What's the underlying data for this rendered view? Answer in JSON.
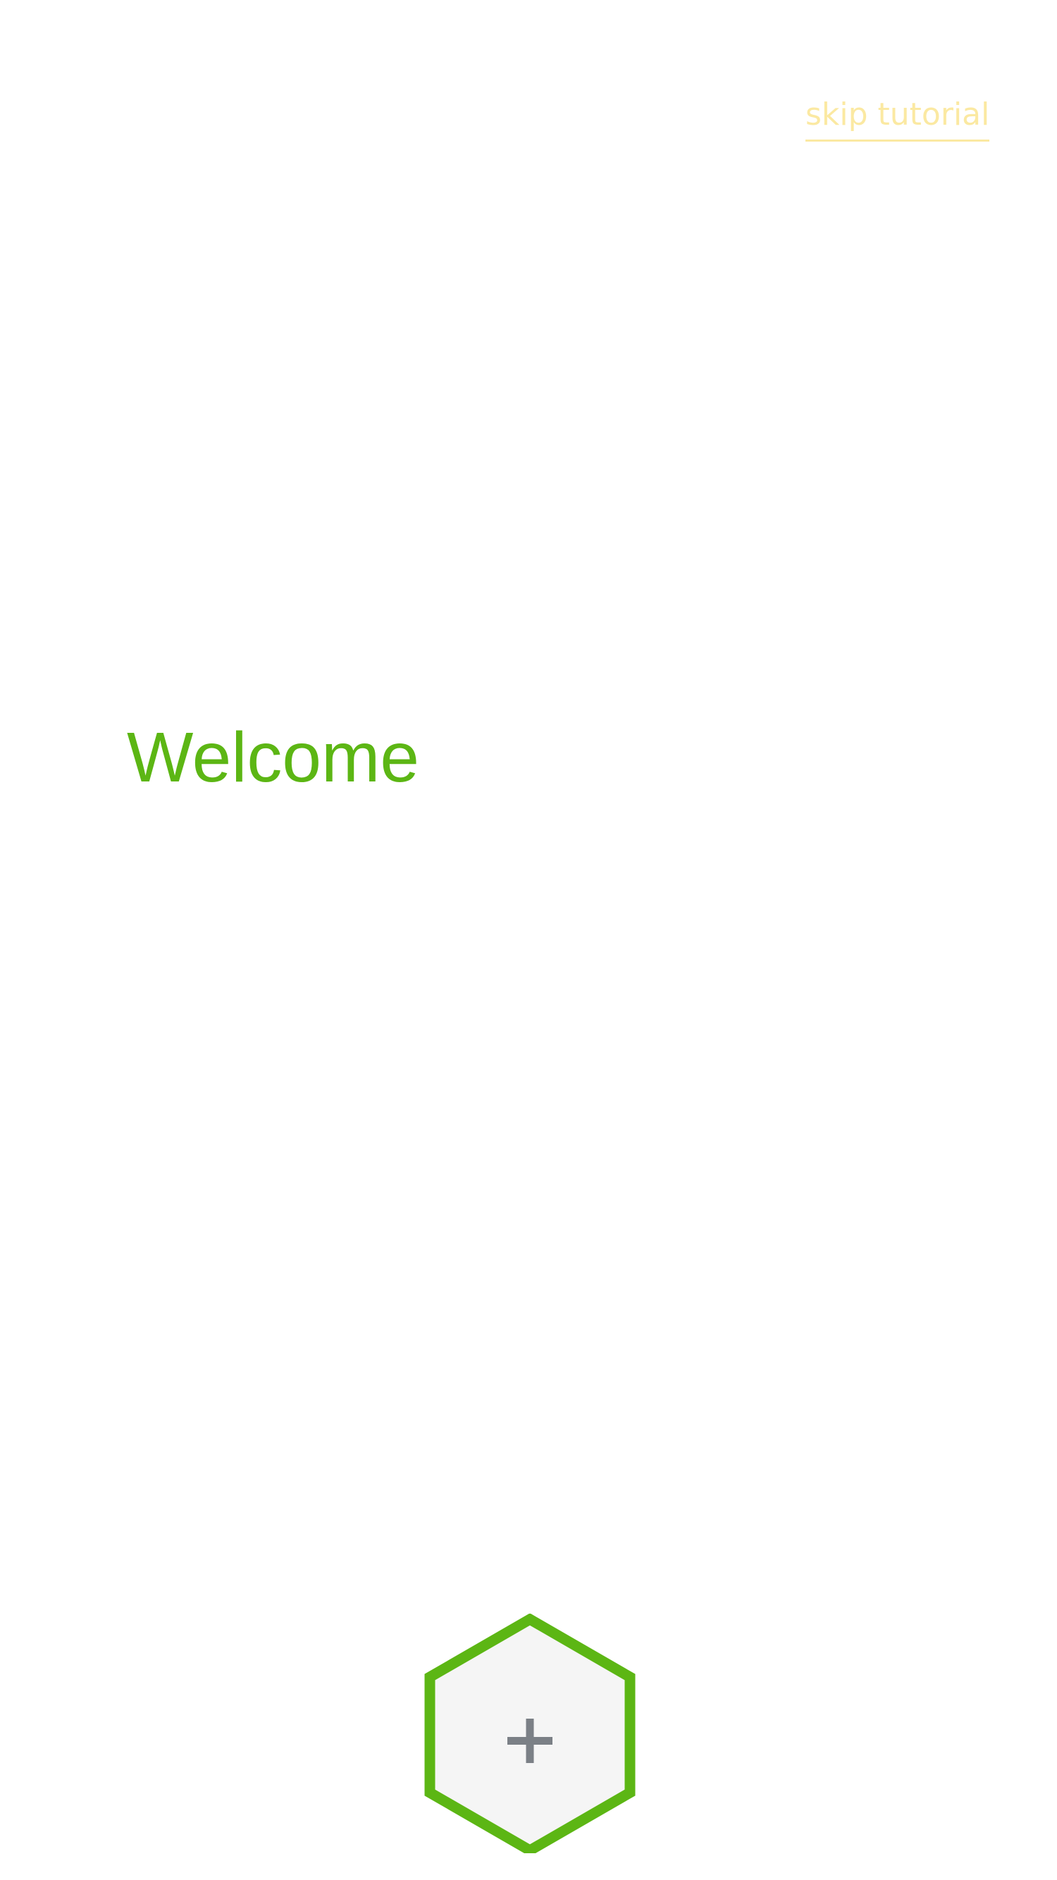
{
  "header": {
    "skip_label": "skip tutorial"
  },
  "main": {
    "title": "Welcome"
  },
  "add_button": {
    "icon": "plus-icon",
    "glyph": "+"
  },
  "colors": {
    "accent_green": "#5cb614",
    "skip_yellow": "#fbe9a2",
    "hexagon_fill": "#f5f5f5",
    "plus_gray": "#7b8086",
    "background": "#ffffff"
  }
}
